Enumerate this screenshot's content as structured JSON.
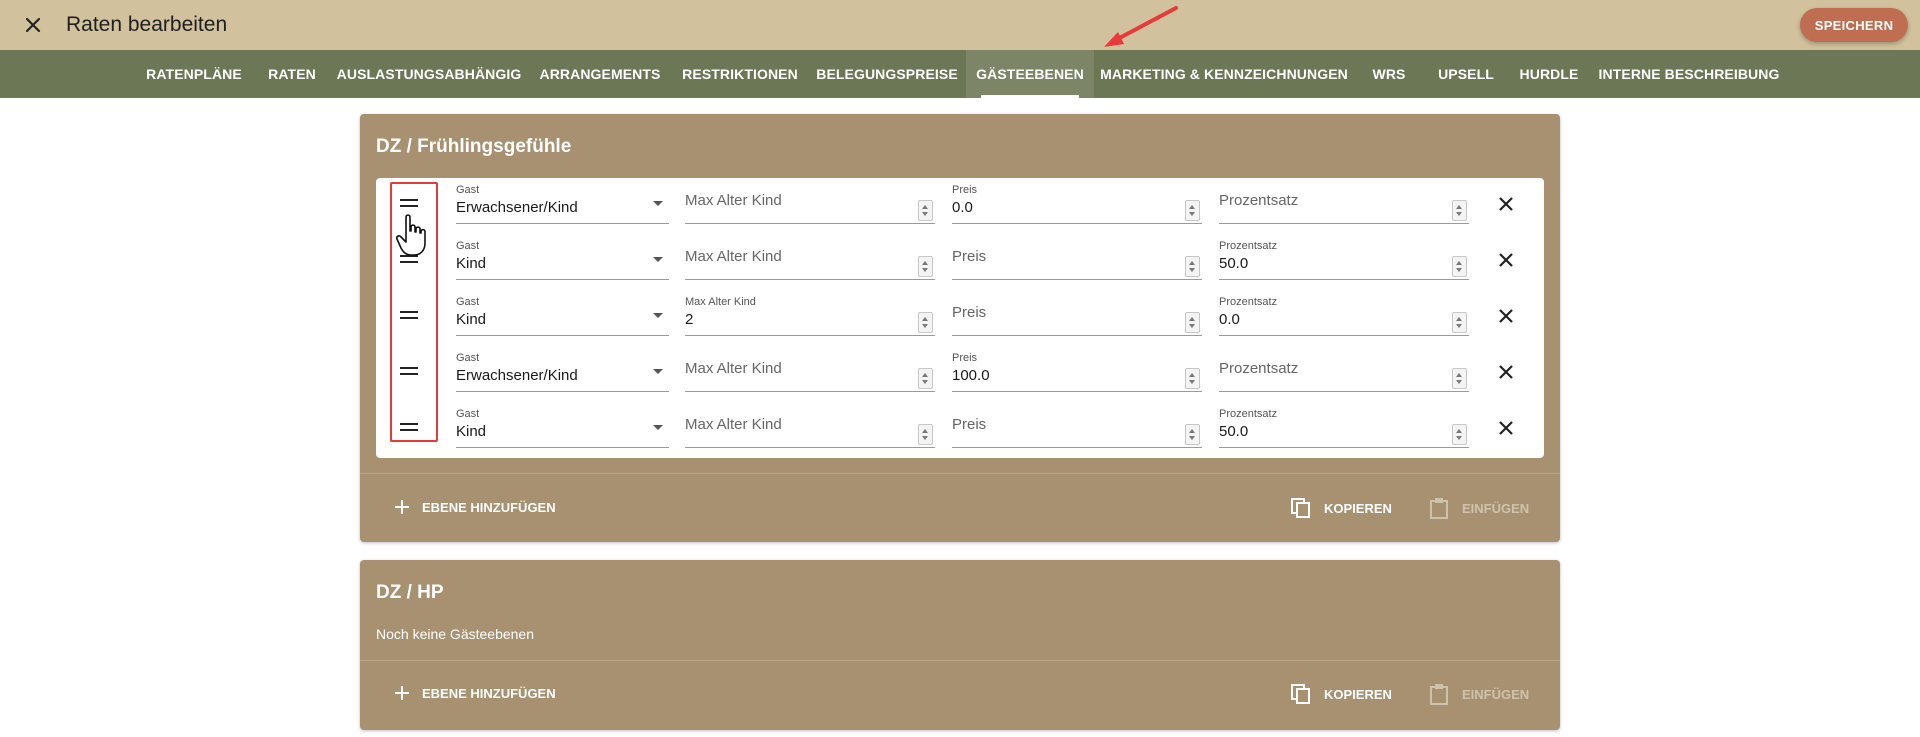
{
  "header": {
    "title": "Raten bearbeiten",
    "save_label": "SPEICHERN",
    "close_icon": "close-icon",
    "colors": {
      "header_bg": "#d1c19c",
      "save_bg": "#c06e52"
    }
  },
  "tabs": [
    {
      "label": "RATENPLÄNE"
    },
    {
      "label": "RATEN"
    },
    {
      "label": "AUSLASTUNGSABHÄNGIG"
    },
    {
      "label": "ARRANGEMENTS"
    },
    {
      "label": "RESTRIKTIONEN"
    },
    {
      "label": "BELEGUNGSPREISE"
    },
    {
      "label": "GÄSTEEBENEN",
      "active": true
    },
    {
      "label": "MARKETING & KENNZEICHNUNGEN"
    },
    {
      "label": "WRS"
    },
    {
      "label": "UPSELL"
    },
    {
      "label": "HURDLE"
    },
    {
      "label": "INTERNE BESCHREIBUNG"
    }
  ],
  "card1": {
    "title": "DZ / Frühlingsgefühle",
    "rows": [
      {
        "gast_label": "Gast",
        "gast": "Erwachsener/Kind",
        "max_label": "",
        "max_placeholder": "Max Alter Kind",
        "max_value": "",
        "preis_label": "Preis",
        "preis_placeholder": "",
        "preis_value": "0.0",
        "proz_label": "",
        "proz_placeholder": "Prozentsatz",
        "proz_value": ""
      },
      {
        "gast_label": "Gast",
        "gast": "Kind",
        "max_label": "",
        "max_placeholder": "Max Alter Kind",
        "max_value": "",
        "preis_label": "",
        "preis_placeholder": "Preis",
        "preis_value": "",
        "proz_label": "Prozentsatz",
        "proz_placeholder": "",
        "proz_value": "50.0"
      },
      {
        "gast_label": "Gast",
        "gast": "Kind",
        "max_label": "Max Alter Kind",
        "max_placeholder": "",
        "max_value": "2",
        "preis_label": "",
        "preis_placeholder": "Preis",
        "preis_value": "",
        "proz_label": "Prozentsatz",
        "proz_placeholder": "",
        "proz_value": "0.0"
      },
      {
        "gast_label": "Gast",
        "gast": "Erwachsener/Kind",
        "max_label": "",
        "max_placeholder": "Max Alter Kind",
        "max_value": "",
        "preis_label": "Preis",
        "preis_placeholder": "",
        "preis_value": "100.0",
        "proz_label": "",
        "proz_placeholder": "Prozentsatz",
        "proz_value": ""
      },
      {
        "gast_label": "Gast",
        "gast": "Kind",
        "max_label": "",
        "max_placeholder": "Max Alter Kind",
        "max_value": "",
        "preis_label": "",
        "preis_placeholder": "Preis",
        "preis_value": "",
        "proz_label": "Prozentsatz",
        "proz_placeholder": "",
        "proz_value": "50.0"
      }
    ],
    "add_label": "EBENE HINZUFÜGEN",
    "copy_label": "KOPIEREN",
    "paste_label": "EINFÜGEN"
  },
  "card2": {
    "title": "DZ / HP",
    "empty_text": "Noch keine Gästeebenen",
    "add_label": "EBENE HINZUFÜGEN",
    "copy_label": "KOPIEREN",
    "paste_label": "EINFÜGEN"
  },
  "icons": {
    "drag": "drag-handle-icon",
    "delete": "close-icon",
    "add": "plus-icon",
    "copy": "copy-icon",
    "paste": "clipboard-icon"
  },
  "annotation": {
    "arrow_color": "#e83a3a",
    "highlight_color": "#e23b3b"
  }
}
